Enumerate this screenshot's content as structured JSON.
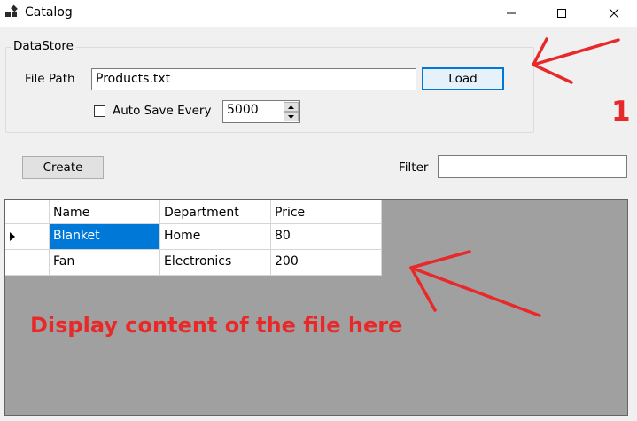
{
  "window": {
    "title": "Catalog",
    "icons": {
      "app": "app-icon",
      "minimize": "minimize-icon",
      "maximize": "maximize-icon",
      "close": "close-icon"
    }
  },
  "datastore": {
    "group_label": "DataStore",
    "file_path_label": "File Path",
    "file_path_value": "Products.txt",
    "load_label": "Load",
    "auto_save_label": "Auto Save Every",
    "auto_save_checked": false,
    "auto_save_value": "5000"
  },
  "toolbar": {
    "create_label": "Create",
    "filter_label": "Filter",
    "filter_value": ""
  },
  "grid": {
    "columns": [
      "Name",
      "Department",
      "Price"
    ],
    "rows": [
      {
        "name": "Blanket",
        "department": "Home",
        "price": "80",
        "selected": true
      },
      {
        "name": "Fan",
        "department": "Electronics",
        "price": "200",
        "selected": false
      }
    ]
  },
  "annotations": {
    "number": "1",
    "caption": "Display content of the file here",
    "color": "#e8292a"
  }
}
